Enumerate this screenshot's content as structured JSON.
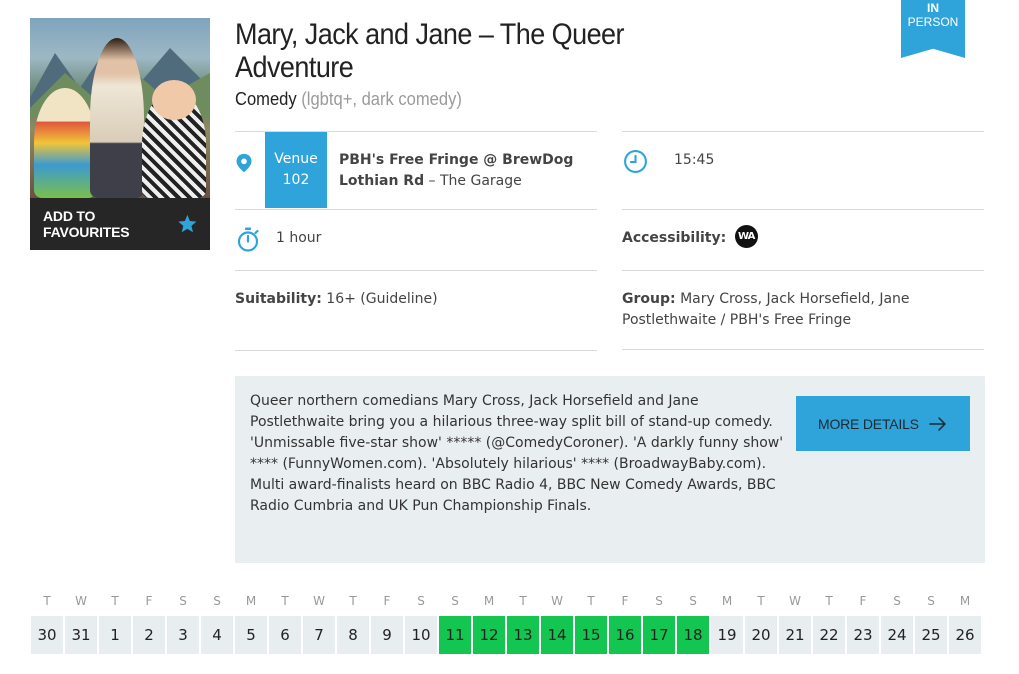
{
  "show": {
    "title": "Mary, Jack and Jane – The Queer Adventure",
    "genre": "Comedy",
    "tags": "(lgbtq+, dark comedy)",
    "format_badge": {
      "line1": "IN",
      "line2": "PERSON"
    }
  },
  "favourites": {
    "label": "ADD TO FAVOURITES"
  },
  "venue": {
    "label": "Venue",
    "number": "102",
    "name": "PBH's Free Fringe @ BrewDog Lothian Rd",
    "room": "– The Garage"
  },
  "time": "15:45",
  "duration": "1 hour",
  "accessibility": {
    "label": "Accessibility:",
    "badge": "WA"
  },
  "suitability": {
    "label": "Suitability:",
    "value": "16+ (Guideline)"
  },
  "group": {
    "label": "Group:",
    "value": "Mary Cross, Jack Horsefield, Jane Postlethwaite / PBH's Free Fringe"
  },
  "description": "Queer northern comedians Mary Cross, Jack Horsefield and Jane Postlethwaite bring you a hilarious three-way split bill of stand-up comedy. 'Unmissable five-star show' ***** (@ComedyCoroner). 'A darkly funny show' **** (FunnyWomen.com). 'Absolutely hilarious' **** (BroadwayBaby.com). Multi award-finalists heard on BBC Radio 4, BBC New Comedy Awards, BBC Radio Cumbria and UK Pun Championship Finals.",
  "more_details": {
    "label": "MORE DETAILS"
  },
  "colors": {
    "accent": "#2fa4da",
    "performance_day": "#12c651",
    "dark": "#262626",
    "panel": "#e9eef1"
  },
  "icons": {
    "star": "star-icon",
    "location": "location-pin-icon",
    "clock": "clock-icon",
    "stopwatch": "stopwatch-icon",
    "arrow": "arrow-right-icon"
  },
  "calendar": [
    {
      "dow": "T",
      "day": "30",
      "performance": false
    },
    {
      "dow": "W",
      "day": "31",
      "performance": false
    },
    {
      "dow": "T",
      "day": "1",
      "performance": false
    },
    {
      "dow": "F",
      "day": "2",
      "performance": false
    },
    {
      "dow": "S",
      "day": "3",
      "performance": false
    },
    {
      "dow": "S",
      "day": "4",
      "performance": false
    },
    {
      "dow": "M",
      "day": "5",
      "performance": false
    },
    {
      "dow": "T",
      "day": "6",
      "performance": false
    },
    {
      "dow": "W",
      "day": "7",
      "performance": false
    },
    {
      "dow": "T",
      "day": "8",
      "performance": false
    },
    {
      "dow": "F",
      "day": "9",
      "performance": false
    },
    {
      "dow": "S",
      "day": "10",
      "performance": false
    },
    {
      "dow": "S",
      "day": "11",
      "performance": true
    },
    {
      "dow": "M",
      "day": "12",
      "performance": true
    },
    {
      "dow": "T",
      "day": "13",
      "performance": true
    },
    {
      "dow": "W",
      "day": "14",
      "performance": true
    },
    {
      "dow": "T",
      "day": "15",
      "performance": true
    },
    {
      "dow": "F",
      "day": "16",
      "performance": true
    },
    {
      "dow": "S",
      "day": "17",
      "performance": true
    },
    {
      "dow": "S",
      "day": "18",
      "performance": true
    },
    {
      "dow": "M",
      "day": "19",
      "performance": false
    },
    {
      "dow": "T",
      "day": "20",
      "performance": false
    },
    {
      "dow": "W",
      "day": "21",
      "performance": false
    },
    {
      "dow": "T",
      "day": "22",
      "performance": false
    },
    {
      "dow": "F",
      "day": "23",
      "performance": false
    },
    {
      "dow": "S",
      "day": "24",
      "performance": false
    },
    {
      "dow": "S",
      "day": "25",
      "performance": false
    },
    {
      "dow": "M",
      "day": "26",
      "performance": false
    }
  ]
}
